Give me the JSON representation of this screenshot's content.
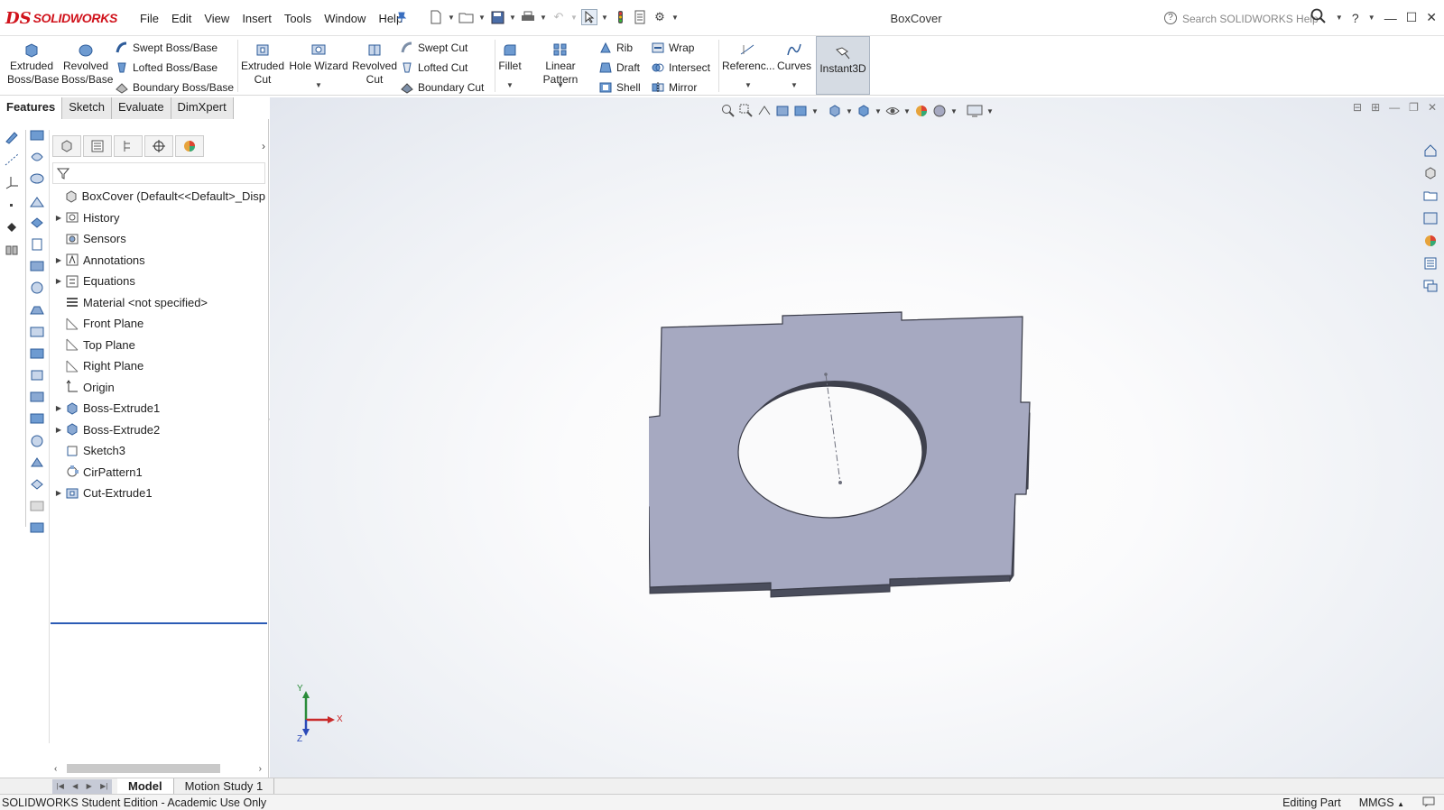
{
  "app": {
    "logo_prefix": "DS",
    "logo_text": "SOLIDWORKS",
    "document_title": "BoxCover",
    "search_placeholder": "Search SOLIDWORKS Help"
  },
  "menu": [
    "File",
    "Edit",
    "View",
    "Insert",
    "Tools",
    "Window",
    "Help"
  ],
  "ribbon": {
    "extruded_boss": "Extruded Boss/Base",
    "revolved_boss": "Revolved Boss/Base",
    "swept_boss": "Swept Boss/Base",
    "lofted_boss": "Lofted Boss/Base",
    "boundary_boss": "Boundary Boss/Base",
    "extruded_cut": "Extruded Cut",
    "hole_wizard": "Hole Wizard",
    "revolved_cut": "Revolved Cut",
    "swept_cut": "Swept Cut",
    "lofted_cut": "Lofted Cut",
    "boundary_cut": "Boundary Cut",
    "fillet": "Fillet",
    "linear_pattern": "Linear Pattern",
    "rib": "Rib",
    "draft": "Draft",
    "shell": "Shell",
    "wrap": "Wrap",
    "intersect": "Intersect",
    "mirror": "Mirror",
    "reference": "Referenc...",
    "curves": "Curves",
    "instant3d": "Instant3D"
  },
  "cm_tabs": [
    "Features",
    "Sketch",
    "Evaluate",
    "DimXpert"
  ],
  "tree": {
    "root": "BoxCover  (Default<<Default>_Disp",
    "items": [
      {
        "label": "History",
        "expandable": true,
        "icon": "history-icon"
      },
      {
        "label": "Sensors",
        "expandable": false,
        "icon": "sensors-icon"
      },
      {
        "label": "Annotations",
        "expandable": true,
        "icon": "annotations-icon"
      },
      {
        "label": "Equations",
        "expandable": true,
        "icon": "equations-icon"
      },
      {
        "label": "Material <not specified>",
        "expandable": false,
        "icon": "material-icon"
      },
      {
        "label": "Front Plane",
        "expandable": false,
        "icon": "plane-icon"
      },
      {
        "label": "Top Plane",
        "expandable": false,
        "icon": "plane-icon"
      },
      {
        "label": "Right Plane",
        "expandable": false,
        "icon": "plane-icon"
      },
      {
        "label": "Origin",
        "expandable": false,
        "icon": "origin-icon"
      },
      {
        "label": "Boss-Extrude1",
        "expandable": true,
        "icon": "boss-extrude-icon"
      },
      {
        "label": "Boss-Extrude2",
        "expandable": true,
        "icon": "boss-extrude-icon"
      },
      {
        "label": "Sketch3",
        "expandable": false,
        "icon": "sketch-icon"
      },
      {
        "label": "CirPattern1",
        "expandable": false,
        "icon": "circular-pattern-icon"
      },
      {
        "label": "Cut-Extrude1",
        "expandable": true,
        "icon": "cut-extrude-icon"
      }
    ]
  },
  "bottom_tabs": [
    "Model",
    "Motion Study 1"
  ],
  "status": {
    "left": "SOLIDWORKS Student Edition - Academic Use Only",
    "mode": "Editing Part",
    "units": "MMGS"
  },
  "triad": {
    "x": "X",
    "y": "Y",
    "z": "Z"
  },
  "colors": {
    "brand_red": "#d0121b",
    "part_face": "#a6a9c1",
    "part_edge": "#4a4d5c",
    "selection_blue": "#2b5bb5"
  }
}
